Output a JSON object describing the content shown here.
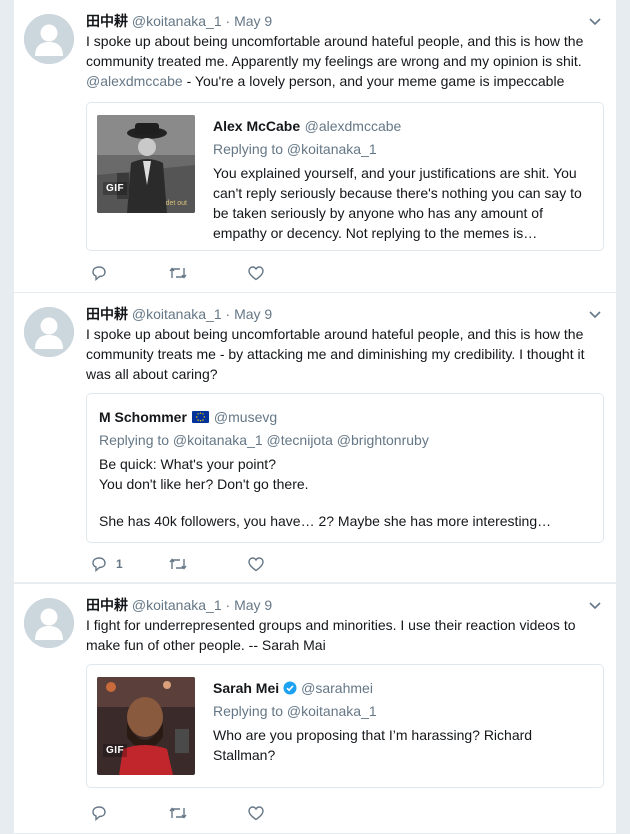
{
  "tweets": [
    {
      "author_name": "田中耕",
      "author_handle": "@koitanaka_1",
      "date_sep": "·",
      "date": "May 9",
      "text": "I spoke up about being uncomfortable around hateful people, and this is how the community treated me. Apparently my feelings are wrong and my opinion is shit.",
      "mention": "@alexdmccabe",
      "text_suffix": " - You're a lovely person, and your meme game is impeccable",
      "quote": {
        "name": "Alex McCabe",
        "handle": "@alexdmccabe",
        "replying_to": "Replying to @koitanaka_1",
        "text": "You explained yourself, and your justifications are shit. You can't reply seriously because there's nothing you can say to be taken seriously by anyone who has any amount of empathy or decency. Not replying to the memes is…",
        "media_badge": "GIF",
        "media_caption": "det out"
      },
      "reply_count": ""
    },
    {
      "author_name": "田中耕",
      "author_handle": "@koitanaka_1",
      "date_sep": "·",
      "date": "May 9",
      "text": "I spoke up about being uncomfortable around hateful people, and this is how the community treats me - by attacking me and diminishing my credibility. I thought it was all about caring?",
      "quote": {
        "name": "M Schommer",
        "flag": "EU flag",
        "handle": "@musevg",
        "replying_to": "Replying to @koitanaka_1 @tecnijota @brightonruby",
        "line1": "Be quick: What's your point?",
        "line2": "You don't like her? Don't go there.",
        "line3": "She has 40k followers, you have… 2? Maybe she has more interesting…"
      },
      "reply_count": "1"
    },
    {
      "author_name": "田中耕",
      "author_handle": "@koitanaka_1",
      "date_sep": "·",
      "date": "May 9",
      "text": "I fight for underrepresented groups and minorities. I use their reaction videos to make fun of other people. -- Sarah Mai",
      "quote": {
        "name": "Sarah Mei",
        "verified": true,
        "handle": "@sarahmei",
        "replying_to": "Replying to @koitanaka_1",
        "text": "Who are you proposing that I’m harassing? Richard Stallman?",
        "media_badge": "GIF"
      },
      "reply_count": ""
    }
  ],
  "colors": {
    "background": "#e6ecf0",
    "secondary_text": "#657786",
    "border": "#e1e8ed",
    "verified_blue": "#1da1f2"
  },
  "icons": [
    "chevron-down-icon",
    "reply-icon",
    "retweet-icon",
    "like-icon",
    "verified-icon",
    "eu-flag-icon",
    "default-avatar-icon"
  ]
}
